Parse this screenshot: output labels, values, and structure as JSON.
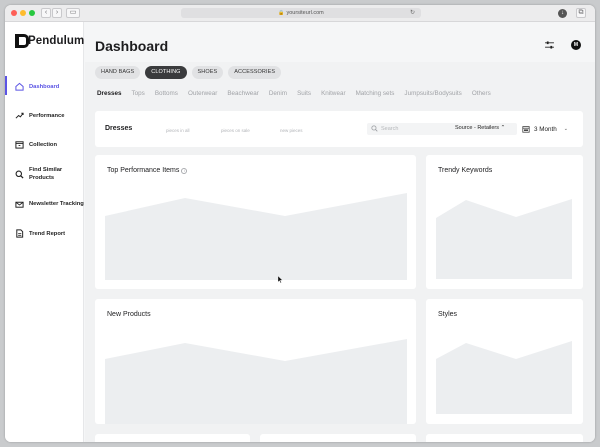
{
  "browser": {
    "url": "yoursiteurl.com",
    "lock_icon": "lock-icon",
    "reload_icon": "reload-icon"
  },
  "app": {
    "name": "Pendulum",
    "logo_icon": "pendulum-logo-icon"
  },
  "sidebar": {
    "items": [
      {
        "label": "Dashboard",
        "icon": "home-icon",
        "active": true
      },
      {
        "label": "Performance",
        "icon": "trend-up-icon",
        "active": false
      },
      {
        "label": "Collection",
        "icon": "collection-icon",
        "active": false
      },
      {
        "label": "Find Similar Products",
        "icon": "search-icon",
        "active": false
      },
      {
        "label": "Newsletter Tracking",
        "icon": "mail-icon",
        "active": false
      },
      {
        "label": "Trend Report",
        "icon": "document-icon",
        "active": false
      }
    ]
  },
  "header": {
    "title": "Dashboard",
    "filter_icon": "sliders-icon",
    "avatar_initial": "M"
  },
  "category_tabs": [
    {
      "label": "HAND BAGS",
      "active": false
    },
    {
      "label": "CLOTHING",
      "active": true
    },
    {
      "label": "SHOES",
      "active": false
    },
    {
      "label": "ACCESSORIES",
      "active": false
    }
  ],
  "subcategory_tabs": [
    {
      "label": "Dresses",
      "active": true
    },
    {
      "label": "Tops",
      "active": false
    },
    {
      "label": "Bottoms",
      "active": false
    },
    {
      "label": "Outerwear",
      "active": false
    },
    {
      "label": "Beachwear",
      "active": false
    },
    {
      "label": "Denim",
      "active": false
    },
    {
      "label": "Suits",
      "active": false
    },
    {
      "label": "Knitwear",
      "active": false
    },
    {
      "label": "Matching sets",
      "active": false
    },
    {
      "label": "Jumpsuits/Bodysuits",
      "active": false
    },
    {
      "label": "Others",
      "active": false
    }
  ],
  "summary_bar": {
    "title": "Dresses",
    "stats": [
      "pieces in all",
      "pieces on sale",
      "new pieces"
    ],
    "search_placeholder": "Search",
    "source_label": "Source - Retailers",
    "range_label": "3 Month"
  },
  "cards": {
    "top_performance": {
      "title": "Top Performance Items",
      "info_icon": "i"
    },
    "trendy_keywords": {
      "title": "Trendy Keywords"
    },
    "new_products": {
      "title": "New Products"
    },
    "styles": {
      "title": "Styles"
    }
  },
  "colors": {
    "accent": "#5b54e4",
    "active_tab": "#3a3b3d",
    "placeholder_fill": "#eceef0"
  }
}
